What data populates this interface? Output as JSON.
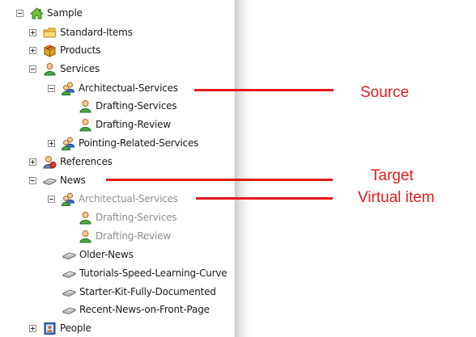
{
  "tree": {
    "items": [
      {
        "label": "Sample"
      },
      {
        "label": "Standard-Items"
      },
      {
        "label": "Products"
      },
      {
        "label": "Services"
      },
      {
        "label": "Architectual-Services"
      },
      {
        "label": "Drafting-Services"
      },
      {
        "label": "Drafting-Review"
      },
      {
        "label": "Pointing-Related-Services"
      },
      {
        "label": "References"
      },
      {
        "label": "News"
      },
      {
        "label": "Architectual-Services"
      },
      {
        "label": "Drafting-Services"
      },
      {
        "label": "Drafting-Review"
      },
      {
        "label": "Older-News"
      },
      {
        "label": "Tutorials-Speed-Learning-Curve"
      },
      {
        "label": "Starter-Kit-Fully-Documented"
      },
      {
        "label": "Recent-News-on-Front-Page"
      },
      {
        "label": "People"
      }
    ]
  },
  "callouts": {
    "source": "Source",
    "target": "Target",
    "virtual": "Virtual item"
  },
  "colors": {
    "callout": "#e31b1b",
    "virtual_text": "#8e8e8e"
  }
}
